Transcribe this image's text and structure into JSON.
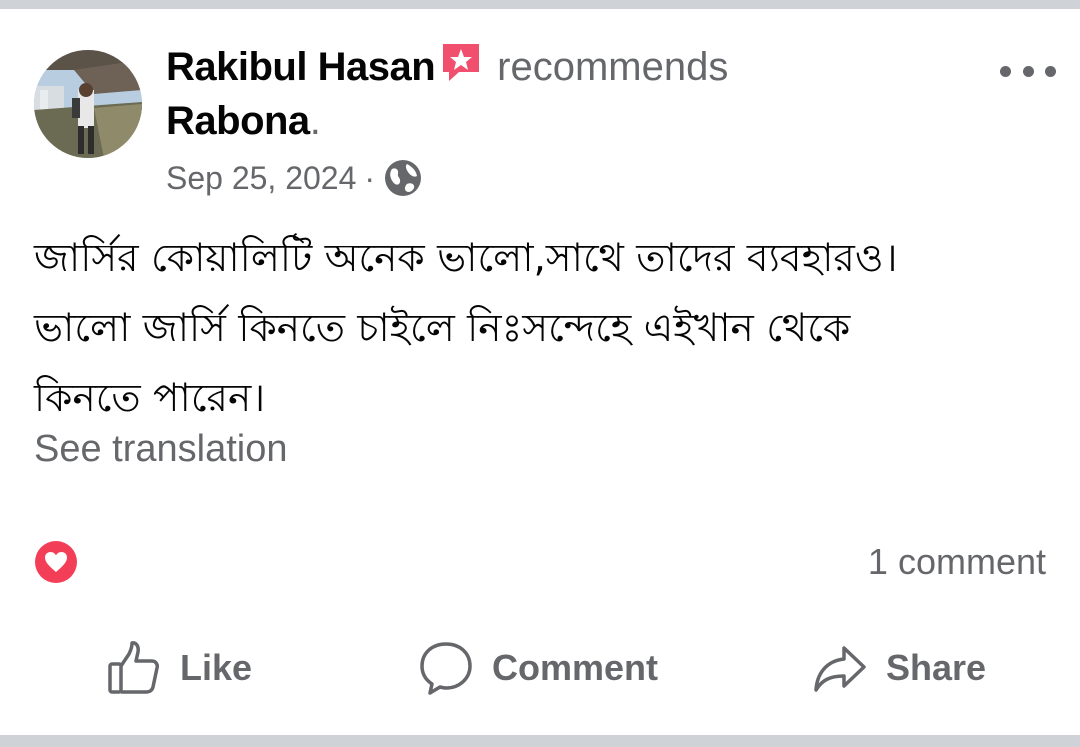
{
  "post": {
    "author_name": "Rakibul Hasan",
    "action_text": "recommends",
    "page_name": "Rabona",
    "period": ".",
    "date": "Sep 25, 2024",
    "separator": "·",
    "privacy_icon": "globe-icon",
    "badge_icon": "recommend-badge-icon",
    "body_lines": [
      "জার্সির কোয়ালিটি অনেক ভালো,সাথে তাদের ব্যবহারও।",
      "ভালো জার্সি কিনতে চাইলে নিঃসন্দেহে এইখান থেকে",
      "কিনতে পারেন।"
    ],
    "see_translation": "See translation"
  },
  "stats": {
    "reaction_icon": "heart-reaction-icon",
    "comment_count": "1 comment"
  },
  "actions": {
    "like_label": "Like",
    "comment_label": "Comment",
    "share_label": "Share"
  },
  "colors": {
    "primary_text": "#050505",
    "secondary_text": "#65676b",
    "reaction_red": "#f33e58",
    "badge_pink": "#f0506e",
    "divider": "#cfd2d6"
  }
}
